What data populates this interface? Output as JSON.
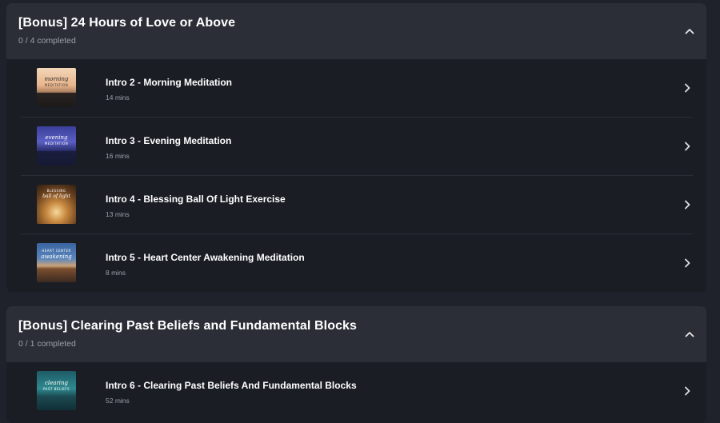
{
  "modules": [
    {
      "title": "[Bonus] 24 Hours of Love or Above",
      "progress": "0 / 4 completed",
      "collapse_icon": "chevron-up-icon",
      "lessons": [
        {
          "title": "Intro 2 - Morning Meditation",
          "duration": "14 mins",
          "thumb_script": "morning",
          "thumb_sub": "MEDITATION"
        },
        {
          "title": "Intro 3 - Evening Meditation",
          "duration": "16 mins",
          "thumb_script": "evening",
          "thumb_sub": "MEDITATION"
        },
        {
          "title": "Intro 4 - Blessing Ball Of Light Exercise",
          "duration": "13 mins",
          "thumb_script": "ball of light",
          "thumb_sub": "BLESSING"
        },
        {
          "title": "Intro 5 - Heart Center Awakening Meditation",
          "duration": "8 mins",
          "thumb_script": "awakening",
          "thumb_sub": "HEART CENTER"
        }
      ]
    },
    {
      "title": "[Bonus] Clearing Past Beliefs and Fundamental Blocks",
      "progress": "0 / 1 completed",
      "collapse_icon": "chevron-up-icon",
      "lessons": [
        {
          "title": "Intro 6 - Clearing Past Beliefs And Fundamental Blocks",
          "duration": "52 mins",
          "thumb_script": "clearing",
          "thumb_sub": "PAST BELIEFS"
        }
      ]
    }
  ],
  "colors": {
    "page_bg": "#1f222b",
    "card_bg": "#1a1d24",
    "header_bg": "#2b2e37",
    "text_primary": "#ffffff",
    "text_secondary": "#9aa0aa"
  }
}
